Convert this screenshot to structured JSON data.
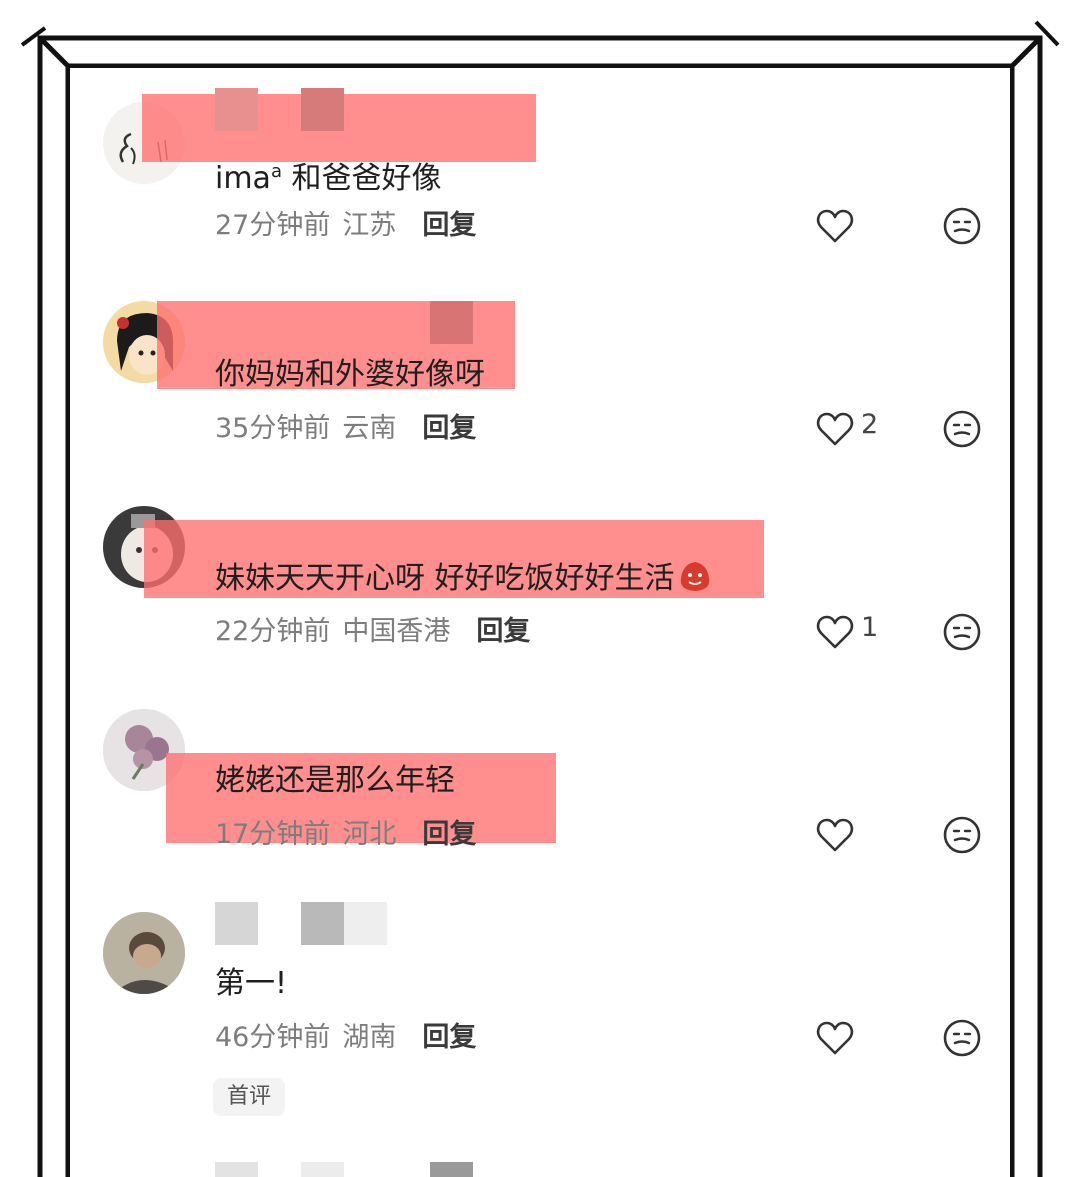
{
  "comments": [
    {
      "text_prefix": "ima",
      "text_icon": "search-glyph",
      "text": "和爸爸好像",
      "time": "27分钟前",
      "location": "江苏",
      "reply_label": "回复",
      "likes": "",
      "avatar": "sketch-avatar-icon"
    },
    {
      "text": "你妈妈和外婆好像呀",
      "time": "35分钟前",
      "location": "云南",
      "reply_label": "回复",
      "likes": "2",
      "avatar": "anime-girl-avatar-icon"
    },
    {
      "text": "妹妹天天开心呀 好好吃饭好好生活",
      "text_emoji": "red-blob-emoji",
      "time": "22分钟前",
      "location": "中国香港",
      "reply_label": "回复",
      "likes": "1",
      "avatar": "doll-avatar-icon"
    },
    {
      "text": "姥姥还是那么年轻",
      "time": "17分钟前",
      "location": "河北",
      "reply_label": "回复",
      "likes": "",
      "avatar": "flower-avatar-icon"
    },
    {
      "text": "第一!",
      "time": "46分钟前",
      "location": "湖南",
      "reply_label": "回复",
      "likes": "",
      "badge": "首评",
      "avatar": "person-avatar-icon"
    }
  ],
  "colors": {
    "highlight": "#ff6e6e",
    "meta_text": "#7d7d7d",
    "body_text": "#1f1f1f",
    "frame": "#111111"
  },
  "icons": {
    "like": "heart-outline-icon",
    "dislike": "neutral-face-icon"
  }
}
